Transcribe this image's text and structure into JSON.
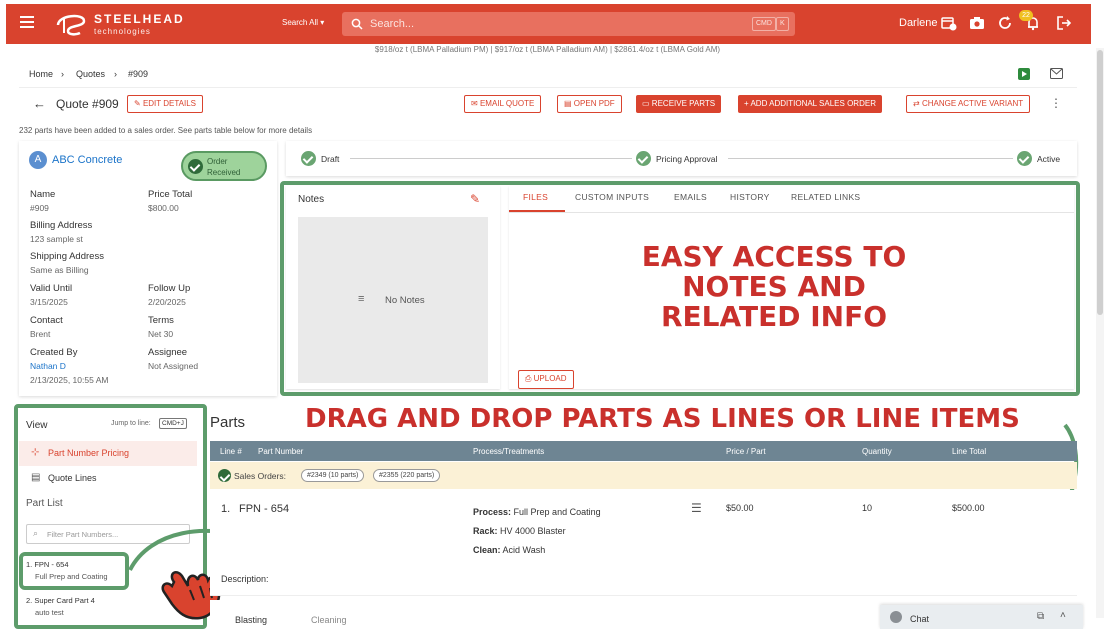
{
  "app": {
    "logo_title": "STEELHEAD",
    "logo_sub": "technologies"
  },
  "header": {
    "search_scope": "Search All",
    "search_placeholder": "Search...",
    "search_kbd1": "CMD",
    "search_kbd2": "K",
    "user_name": "Darlene",
    "notification_count": "22"
  },
  "ticker": {
    "text": "$918/oz t (LBMA Palladium PM)  |  $917/oz t (LBMA Palladium AM)  |  $2861.4/oz t (LBMA Gold AM)"
  },
  "breadcrumb": {
    "home": "Home",
    "quotes": "Quotes",
    "current": "#909"
  },
  "title": {
    "quote": "Quote #909",
    "edit": "EDIT DETAILS",
    "email": "EMAIL QUOTE",
    "pdf": "OPEN PDF",
    "receive": "RECEIVE PARTS",
    "add_order": "+ ADD ADDITIONAL SALES ORDER",
    "change_variant": "CHANGE ACTIVE VARIANT"
  },
  "notice": "232 parts have been added to a sales order. See parts table below for more details",
  "customer": {
    "avatar": "A",
    "name": "ABC Concrete",
    "status_line1": "Order",
    "status_line2": "Received",
    "fields": {
      "name_label": "Name",
      "name_value": "#909",
      "price_label": "Price Total",
      "price_value": "$800.00",
      "billing_label": "Billing Address",
      "billing_value": "123 sample st",
      "shipping_label": "Shipping Address",
      "shipping_value": "Same as Billing",
      "valid_label": "Valid Until",
      "valid_value": "3/15/2025",
      "follow_label": "Follow Up",
      "follow_value": "2/20/2025",
      "contact_label": "Contact",
      "contact_value": "Brent",
      "terms_label": "Terms",
      "terms_value": "Net 30",
      "created_label": "Created By",
      "created_value": "Nathan D",
      "created_date": "2/13/2025, 10:55 AM",
      "assignee_label": "Assignee",
      "assignee_value": "Not Assigned"
    }
  },
  "steps": {
    "s1": "Draft",
    "s2": "Pricing Approval",
    "s3": "Active"
  },
  "notes": {
    "title": "Notes",
    "empty": "No Notes"
  },
  "files": {
    "tabs": [
      "FILES",
      "CUSTOM INPUTS",
      "EMAILS",
      "HISTORY",
      "RELATED LINKS"
    ],
    "upload": "UPLOAD"
  },
  "callouts": {
    "top_line1": "EASY ACCESS TO",
    "top_line2": "NOTES AND",
    "top_line3": "RELATED INFO",
    "bottom": "DRAG AND DROP PARTS AS LINES OR LINE ITEMS"
  },
  "view": {
    "title": "View",
    "jump_label": "Jump to line:",
    "jump_kbd": "CMD+J",
    "item1": "Part Number Pricing",
    "item2": "Quote Lines",
    "part_list": "Part List",
    "filter_placeholder": "Filter Part Numbers...",
    "parts": [
      {
        "name": "1. FPN - 654",
        "sub": "Full Prep and Coating"
      },
      {
        "name": "2. Super Card Part 4",
        "sub": "auto test"
      }
    ]
  },
  "parts": {
    "title": "Parts",
    "headers": [
      "Line #",
      "Part Number",
      "Process/Treatments",
      "Price / Part",
      "Quantity",
      "Line Total"
    ],
    "sales_label": "Sales Orders:",
    "chip1": "#2349 (10 parts)",
    "chip2": "#2355 (220 parts)",
    "line1": {
      "num": "1.",
      "part": "FPN - 654",
      "process_label": "Process:",
      "process": "Full Prep and Coating",
      "rack_label": "Rack:",
      "rack": "HV 4000 Blaster",
      "clean_label": "Clean:",
      "clean": "Acid Wash",
      "price": "$50.00",
      "qty": "10",
      "total": "$500.00",
      "desc_label": "Description:"
    },
    "subtabs": [
      "Blasting",
      "Cleaning"
    ]
  },
  "chat": {
    "label": "Chat"
  }
}
